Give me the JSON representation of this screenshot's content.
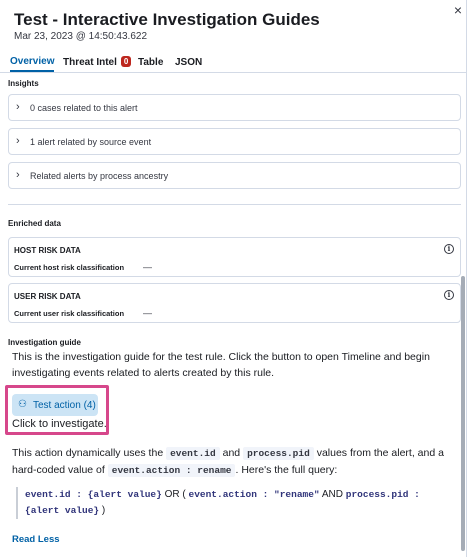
{
  "flyout": {
    "title": "Test - Interactive Investigation Guides",
    "timestamp": "Mar 23, 2023 @ 14:50:43.622",
    "close_glyph": "×"
  },
  "tabs": [
    {
      "label": "Overview",
      "active": true
    },
    {
      "label": "Threat Intel",
      "badge": "0"
    },
    {
      "label": "Table"
    },
    {
      "label": "JSON"
    }
  ],
  "insights": {
    "title": "Insights",
    "items": [
      "0 cases related to this alert",
      "1 alert related by source event",
      "Related alerts by process ancestry"
    ]
  },
  "enriched": {
    "title": "Enriched data",
    "host": {
      "title": "HOST RISK DATA",
      "row_label": "Current host risk classification",
      "row_value": "—"
    },
    "user": {
      "title": "USER RISK DATA",
      "row_label": "Current user risk classification",
      "row_value": "—"
    }
  },
  "guide": {
    "title": "Investigation guide",
    "intro": "This is the investigation guide for the test rule. Click the button to open Timeline and begin investigating events related to alerts created by this rule.",
    "action_button": "Test action (4)",
    "click_text": "Click to investigate.",
    "p_part1": "This action dynamically uses the",
    "code_event_id": "event.id",
    "p_and": "and",
    "code_process_pid": "process.pid",
    "p_part2": "values from the alert, and a hard-coded value of",
    "code_event_action": "event.action : rename",
    "p_part3": ". Here's the full query:",
    "q_code1": "event.id : {alert value}",
    "q_or": "OR (",
    "q_code2": "event.action : \"rename\"",
    "q_and": "AND",
    "q_code3": "process.pid : {alert value}",
    "q_close": ")",
    "read_less": "Read Less"
  },
  "colors": {
    "accent": "#0061a6",
    "badge": "#bd271e",
    "highlight": "#d6478b",
    "action_bg": "#cce4f5"
  }
}
